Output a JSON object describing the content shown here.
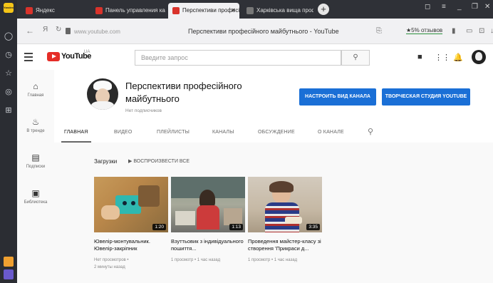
{
  "browser": {
    "sidebar_badge": "Yandex",
    "tabs": [
      {
        "label": "Яндекс",
        "active": false,
        "color": "#d9332b"
      },
      {
        "label": "Панель управления казн",
        "active": false,
        "color": "#d9332b"
      },
      {
        "label": "Перспективи професі",
        "active": true,
        "color": "#d9332b"
      },
      {
        "label": "Харківська вища профес",
        "active": false,
        "color": "#777777"
      }
    ],
    "newtab": "+",
    "address_url": "www.youtube.com",
    "page_title": "Перспективи професійного майбутнього - YouTube",
    "rating": "★5% отзывов"
  },
  "youtube": {
    "logo_text": "YouTube",
    "logo_region": "UA",
    "search_placeholder": "Введите запрос",
    "guide": [
      {
        "icon": "home-icon",
        "glyph": "🏠",
        "label": "Главная"
      },
      {
        "icon": "trending-icon",
        "glyph": "🔥",
        "label": "В тренде"
      },
      {
        "icon": "subscriptions-icon",
        "glyph": "▤",
        "label": "Подписки"
      },
      {
        "icon": "library-icon",
        "glyph": "▣",
        "label": "Библиотека"
      }
    ],
    "channel": {
      "name": "Перспективи професійного майбутнього",
      "subscribers": "Нет подписчиков",
      "customize_button": "НАСТРОИТЬ ВИД КАНАЛА",
      "studio_button": "ТВОРЧЕСКАЯ СТУДИЯ YOUTUBE",
      "tabs": [
        "ГЛАВНАЯ",
        "ВИДЕО",
        "ПЛЕЙЛИСТЫ",
        "КАНАЛЫ",
        "ОБСУЖДЕНИЕ",
        "О КАНАЛЕ"
      ]
    },
    "shelf": {
      "title": "Загрузки",
      "play_all": "▶  ВОСПРОИЗВЕСТИ ВСЕ",
      "videos": [
        {
          "title": "Ювелір-монтувальник. Ювелір-закріпник",
          "duration": "1:20",
          "meta1": "Нет просмотров •",
          "meta2": "2 минуты назад"
        },
        {
          "title": "Взуттьовик з індивідуального пошиття...",
          "duration": "1:13",
          "meta1": "1 просмотр • 1 час назад",
          "meta2": ""
        },
        {
          "title": "Проведення майстер-класу зі створення 'Прикраси д...",
          "duration": "3:35",
          "meta1": "1 просмотр • 1 час назад",
          "meta2": ""
        }
      ]
    }
  }
}
